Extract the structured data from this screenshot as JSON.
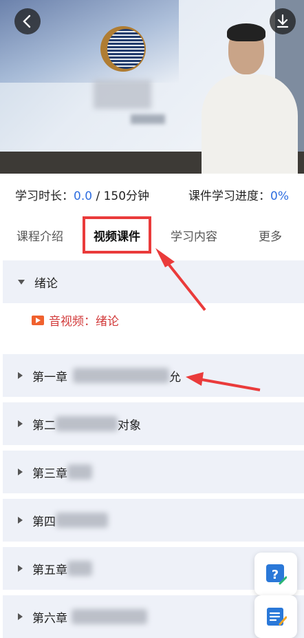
{
  "stats": {
    "study_time_label": "学习时长：",
    "study_time_value": "0.0",
    "study_time_suffix": " / 150分钟",
    "progress_label": "课件学习进度：",
    "progress_value": "0%"
  },
  "tabs": [
    {
      "label": "课程介绍",
      "active": false
    },
    {
      "label": "视频课件",
      "active": true
    },
    {
      "label": "学习内容",
      "active": false
    },
    {
      "label": "更多",
      "active": false
    }
  ],
  "sections": [
    {
      "title": "绪论",
      "expanded": true,
      "lesson_label": "音视频：绪论"
    },
    {
      "title": "第一章",
      "tail": "允"
    },
    {
      "title": "第二",
      "tail": "对象"
    },
    {
      "title": "第三章",
      "tail": ""
    },
    {
      "title": "第四",
      "tail": ""
    },
    {
      "title": "第五章",
      "tail": ""
    },
    {
      "title": "第六章",
      "tail": ""
    }
  ],
  "icons": {
    "back": "chevron-left-icon",
    "download": "download-icon",
    "question": "question-icon",
    "notes": "notes-icon"
  },
  "colors": {
    "accent_blue": "#2f6ee0",
    "annotation_red": "#ea3b3b",
    "lesson_red": "#d23a3a"
  }
}
